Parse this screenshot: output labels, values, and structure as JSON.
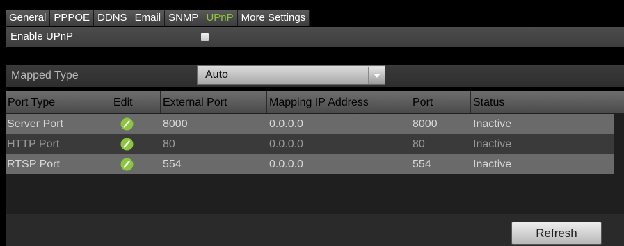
{
  "tabs": [
    {
      "label": "General",
      "active": false
    },
    {
      "label": "PPPOE",
      "active": false
    },
    {
      "label": "DDNS",
      "active": false
    },
    {
      "label": "Email",
      "active": false
    },
    {
      "label": "SNMP",
      "active": false
    },
    {
      "label": "UPnP",
      "active": true
    },
    {
      "label": "More Settings",
      "active": false
    }
  ],
  "enable": {
    "label": "Enable UPnP",
    "checked": false
  },
  "mapped_type": {
    "label": "Mapped Type",
    "value": "Auto"
  },
  "table": {
    "headers": [
      "Port Type",
      "Edit",
      "External Port",
      "Mapping IP Address",
      "Port",
      "Status"
    ],
    "rows": [
      {
        "port_type": "Server Port",
        "edit_icon": "pencil-icon",
        "external_port": "8000",
        "mapping_ip": "0.0.0.0",
        "port": "8000",
        "status": "Inactive"
      },
      {
        "port_type": "HTTP Port",
        "edit_icon": "pencil-icon",
        "external_port": "80",
        "mapping_ip": "0.0.0.0",
        "port": "80",
        "status": "Inactive"
      },
      {
        "port_type": "RTSP Port",
        "edit_icon": "pencil-icon",
        "external_port": "554",
        "mapping_ip": "0.0.0.0",
        "port": "554",
        "status": "Inactive"
      }
    ]
  },
  "buttons": {
    "refresh": "Refresh"
  },
  "colors": {
    "active_tab": "#8cc63f",
    "edit_icon": "#8cc63f"
  }
}
